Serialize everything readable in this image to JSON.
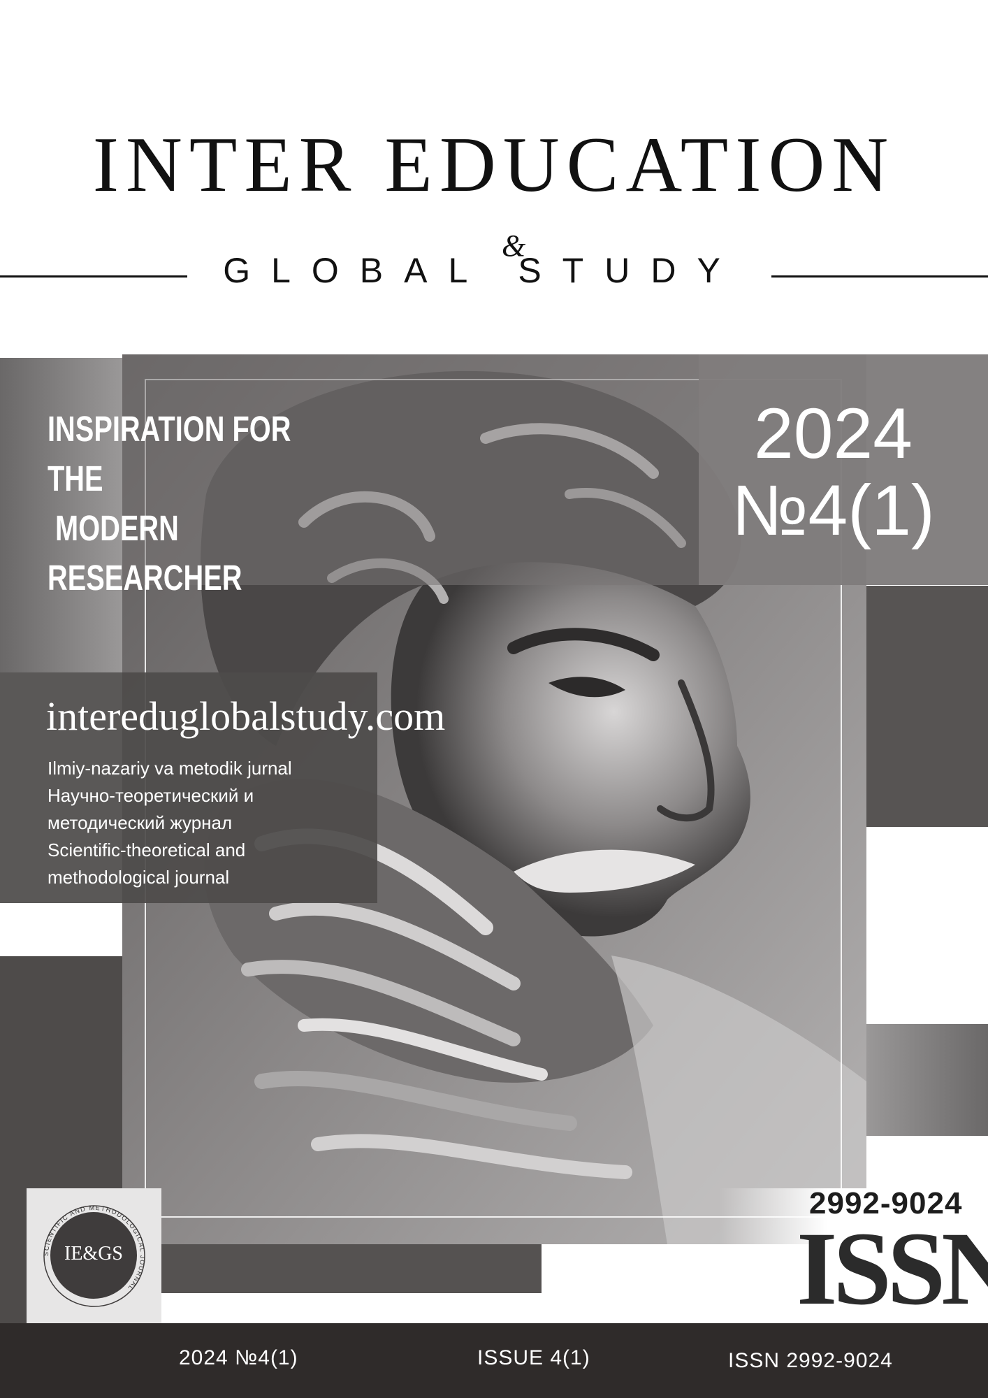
{
  "masthead": {
    "title": "INTER EDUCATION",
    "ampersand": "&",
    "subtitle": "GLOBAL STUDY"
  },
  "cover": {
    "tagline": "INSPIRATION FOR\nTHE\n MODERN\nRESEARCHER",
    "year": "2024",
    "issue_number": "№4(1)",
    "website": "intereduglobalstudy.com",
    "description": [
      "Ilmiy-nazariy va metodik jurnal",
      "Научно-теоретический и",
      "методический журнал",
      "Scientific-theoretical and",
      "methodological journal"
    ]
  },
  "badge": {
    "initials": "IE&GS",
    "ring_text": "SCIENTIFIC AND METHODOLOGICAL JOURNAL"
  },
  "issn_mark": {
    "number": "2992-9024",
    "word": "ISSN"
  },
  "footer": {
    "edition": "2024 №4(1)",
    "issue": "ISSUE 4(1)",
    "issn": "ISSN 2992-9024"
  }
}
